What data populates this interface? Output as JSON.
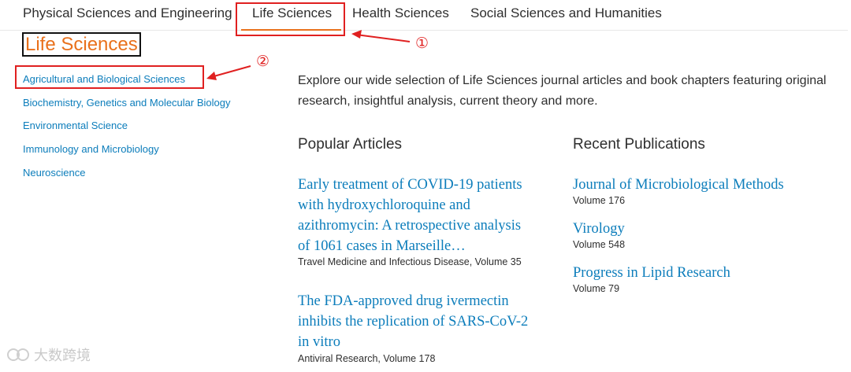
{
  "tabs": [
    {
      "label": "Physical Sciences and Engineering"
    },
    {
      "label": "Life Sciences"
    },
    {
      "label": "Health Sciences"
    },
    {
      "label": "Social Sciences and Humanities"
    }
  ],
  "page_title": "Life Sciences",
  "subjects": [
    "Agricultural and Biological Sciences",
    "Biochemistry, Genetics and Molecular Biology",
    "Environmental Science",
    "Immunology and Microbiology",
    "Neuroscience"
  ],
  "intro": "Explore our wide selection of Life Sciences journal articles and book chapters featuring original research, insightful analysis, current theory and more.",
  "popular": {
    "title": "Popular Articles",
    "articles": [
      {
        "title": "Early treatment of COVID-19 patients with hydroxychloroquine and azithromycin: A retrospective analysis of 1061 cases in Marseille…",
        "meta": "Travel Medicine and Infectious Disease, Volume 35"
      },
      {
        "title": "The FDA-approved drug ivermectin inhibits the replication of SARS-CoV-2 in vitro",
        "meta": "Antiviral Research, Volume 178"
      }
    ]
  },
  "recent": {
    "title": "Recent Publications",
    "items": [
      {
        "title": "Journal of Microbiological Methods",
        "meta": "Volume 176"
      },
      {
        "title": "Virology",
        "meta": "Volume 548"
      },
      {
        "title": "Progress in Lipid Research",
        "meta": "Volume 79"
      }
    ]
  },
  "annotations": {
    "marker1": "①",
    "marker2": "②"
  },
  "watermark": "大数跨境",
  "colors": {
    "accent": "#e9711c",
    "link": "#0c7dbb",
    "annotation": "#e02020"
  }
}
